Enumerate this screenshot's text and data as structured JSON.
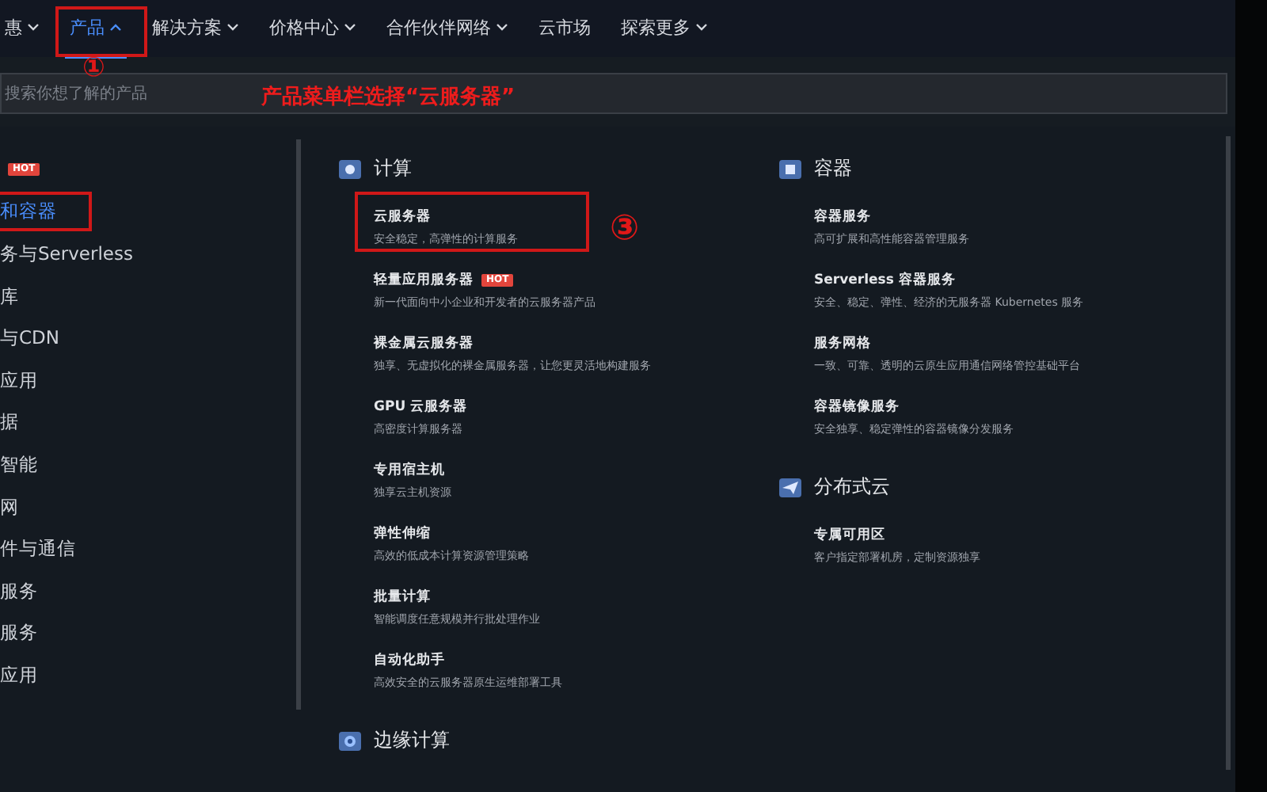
{
  "nav": [
    {
      "label": "惠",
      "caret": true,
      "selected": false
    },
    {
      "label": "产品",
      "caret": true,
      "selected": true
    },
    {
      "label": "解决方案",
      "caret": true,
      "selected": false
    },
    {
      "label": "价格中心",
      "caret": true,
      "selected": false
    },
    {
      "label": "合作伙伴网络",
      "caret": true,
      "selected": false
    },
    {
      "label": "云市场",
      "caret": false,
      "selected": false
    },
    {
      "label": "探索更多",
      "caret": true,
      "selected": false
    }
  ],
  "search": {
    "placeholder": "搜索你想了解的产品"
  },
  "sidebar": {
    "items": [
      {
        "badge": "HOT"
      },
      {
        "label": "和容器",
        "selected": true
      },
      {
        "label": "务与Serverless",
        "selected": false
      },
      {
        "label": "库",
        "selected": false
      },
      {
        "label": "与CDN",
        "selected": false
      },
      {
        "label": "应用",
        "selected": false
      },
      {
        "label": "据",
        "selected": false
      },
      {
        "label": "智能",
        "selected": false
      },
      {
        "label": "网",
        "selected": false
      },
      {
        "label": "件与通信",
        "selected": false
      },
      {
        "label": "服务",
        "selected": false
      },
      {
        "label": "服务",
        "selected": false
      },
      {
        "label": "应用",
        "selected": false
      }
    ]
  },
  "columns": [
    {
      "sections": [
        {
          "title": "计算",
          "items": [
            {
              "name": "云服务器",
              "desc": "安全稳定，高弹性的计算服务",
              "highlighted": true
            },
            {
              "name": "轻量应用服务器",
              "badge": "HOT",
              "desc": "新一代面向中小企业和开发者的云服务器产品",
              "highlighted": false
            },
            {
              "name": "裸金属云服务器",
              "desc": "独享、无虚拟化的裸金属服务器，让您更灵活地构建服务",
              "highlighted": false
            },
            {
              "name": "GPU 云服务器",
              "desc": "高密度计算服务器",
              "highlighted": false
            },
            {
              "name": "专用宿主机",
              "desc": "独享云主机资源",
              "highlighted": false
            },
            {
              "name": "弹性伸缩",
              "desc": "高效的低成本计算资源管理策略",
              "highlighted": false
            },
            {
              "name": "批量计算",
              "desc": "智能调度任意规模并行批处理作业",
              "highlighted": false
            },
            {
              "name": "自动化助手",
              "desc": "高效安全的云服务器原生运维部署工具",
              "highlighted": false
            }
          ]
        },
        {
          "title": "边缘计算"
        }
      ]
    },
    {
      "sections": [
        {
          "title": "容器",
          "items": [
            {
              "name": "容器服务",
              "desc": "高可扩展和高性能容器管理服务",
              "highlighted": false
            },
            {
              "name": "Serverless 容器服务",
              "desc": "安全、稳定、弹性、经济的无服务器 Kubernetes 服务",
              "highlighted": false
            },
            {
              "name": "服务网格",
              "desc": "一致、可靠、透明的云原生应用通信网络管控基础平台",
              "highlighted": false
            },
            {
              "name": "容器镜像服务",
              "desc": "安全独享、稳定弹性的容器镜像分发服务",
              "highlighted": false
            }
          ]
        },
        {
          "title": "分布式云",
          "items": [
            {
              "name": "专属可用区",
              "desc": "客户指定部署机房，定制资源独享",
              "highlighted": false
            }
          ]
        }
      ]
    }
  ],
  "annotations": [
    {
      "kind": "circle",
      "text": "①"
    },
    {
      "kind": "note",
      "text": "产品菜单栏选择“云服务器”"
    },
    {
      "kind": "circle",
      "text": "③"
    }
  ]
}
